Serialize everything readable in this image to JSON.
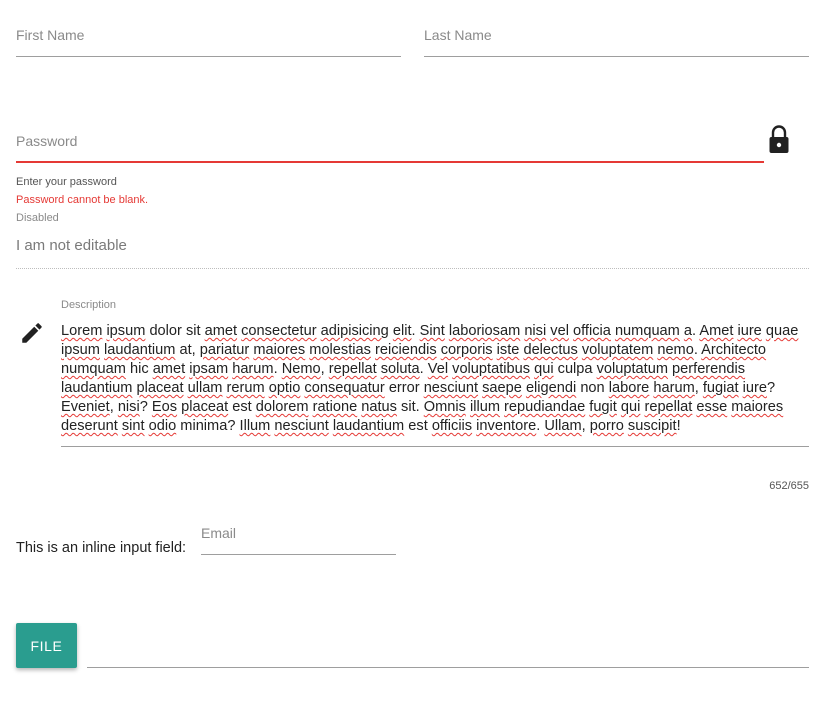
{
  "form": {
    "first_name": {
      "placeholder": "First Name",
      "value": ""
    },
    "last_name": {
      "placeholder": "Last Name",
      "value": ""
    },
    "password": {
      "placeholder": "Password",
      "helper": "Enter your password",
      "error": "Password cannot be blank.",
      "icon": "lock-icon"
    },
    "disabled": {
      "label": "Disabled",
      "value": "I am not editable"
    },
    "description": {
      "label": "Description",
      "icon": "pencil-icon",
      "counter": "652/655",
      "words": [
        "Lorem",
        "ipsum",
        "dolor",
        "sit",
        "amet",
        "consectetur",
        "adipisicing",
        "elit.",
        "Sint",
        "laboriosam",
        "nisi",
        "vel",
        "officia",
        "numquam",
        "a.",
        "Amet",
        "iure",
        "quae",
        "ipsum",
        "laudantium",
        "at,",
        "pariatur",
        "maiores",
        "molestias",
        "reiciendis",
        "corporis",
        "iste",
        "delectus",
        "voluptatem",
        "nemo.",
        "Architecto",
        "numquam",
        "hic",
        "amet",
        "ipsam",
        "harum.",
        "Nemo,",
        "repellat",
        "soluta.",
        "Vel",
        "voluptatibus",
        "qui",
        "culpa",
        "voluptatum",
        "perferendis",
        "laudantium",
        "placeat",
        "ullam",
        "rerum",
        "optio",
        "consequatur",
        "error",
        "nesciunt",
        "saepe",
        "eligendi",
        "non",
        "labore",
        "harum,",
        "fugiat",
        "iure?",
        "Eveniet,",
        "nisi?",
        "Eos",
        "placeat",
        "est",
        "dolorem",
        "ratione",
        "natus",
        "sit.",
        "Omnis",
        "illum",
        "repudiandae",
        "fugit",
        "qui",
        "repellat",
        "esse",
        "maiores",
        "deserunt",
        "sint",
        "odio",
        "minima?",
        "Illum",
        "nesciunt",
        "laudantium",
        "est",
        "officiis",
        "inventore.",
        "Ullam,",
        "porro",
        "suscipit!"
      ],
      "unmarked": [
        "dolor",
        "sit",
        "at,",
        "hic",
        "culpa",
        "error",
        "non",
        "est",
        "sit.",
        "minima?"
      ]
    },
    "inline": {
      "label": "This is an inline input field:",
      "email_placeholder": "Email"
    },
    "file": {
      "button_label": "FILE"
    }
  },
  "colors": {
    "error": "#e53935",
    "accent": "#2a9d8f",
    "icon": "#212121"
  }
}
